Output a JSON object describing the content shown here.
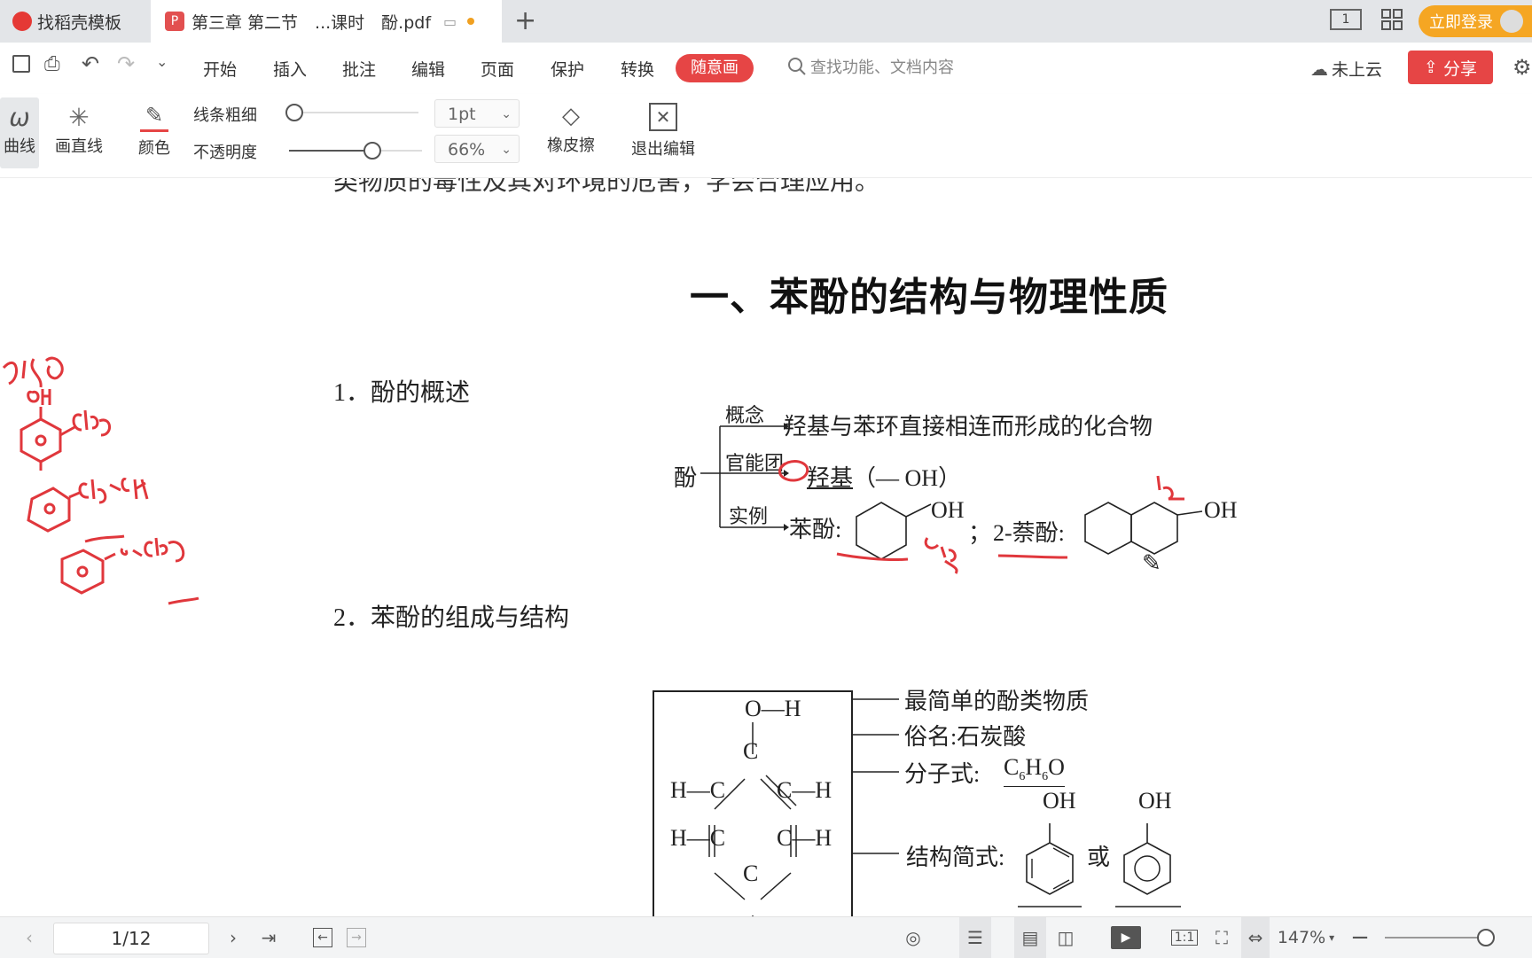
{
  "tabs": [
    {
      "label": "找稻壳模板"
    },
    {
      "label": "第三章 第二节　...课时　酚.pdf"
    }
  ],
  "header": {
    "login_label": "立即登录",
    "cloud_label": "未上云",
    "share_label": "分享",
    "page_indicator": "1"
  },
  "menu": {
    "items": [
      "开始",
      "插入",
      "批注",
      "编辑",
      "页面",
      "保护",
      "转换"
    ],
    "active": "随意画",
    "search_placeholder": "查找功能、文档内容"
  },
  "ribbon": {
    "curve": "曲线",
    "line": "画直线",
    "color": "颜色",
    "thickness_label": "线条粗细",
    "opacity_label": "不透明度",
    "thickness_value": "1pt",
    "opacity_value": "66%",
    "eraser": "橡皮擦",
    "exit": "退出编辑"
  },
  "doc": {
    "prev_line": "类物质的毒性及其对环境的危害，学会合理应用。",
    "heading": "一、苯酚的结构与物理性质",
    "s1_num": "1．",
    "s1_title": "酚的概述",
    "phenol": "酚",
    "concept_label": "概念",
    "concept_text": "羟基与苯环直接相连而形成的化合物",
    "fg_label": "官能团",
    "fg_text": "羟基",
    "fg_formula": "（— OH）",
    "example_label": "实例",
    "example1": "苯酚:",
    "oh": "OH",
    "separator": "；",
    "example2": "2-萘酚:",
    "s2_num": "2．",
    "s2_title": "苯酚的组成与结构",
    "props": [
      "最简单的酚类物质",
      "俗名:石炭酸",
      "分子式:",
      "结构简式:",
      "或"
    ],
    "formula_c": "C",
    "formula_c_sub": "6",
    "formula_h": "H",
    "formula_h_sub": "6",
    "formula_o": "O",
    "atom_oh": "O—H",
    "atom_c": "C",
    "atom_hc": "H—C",
    "atom_ch": "C—H"
  },
  "status": {
    "page": "1/12",
    "zoom": "147%"
  }
}
